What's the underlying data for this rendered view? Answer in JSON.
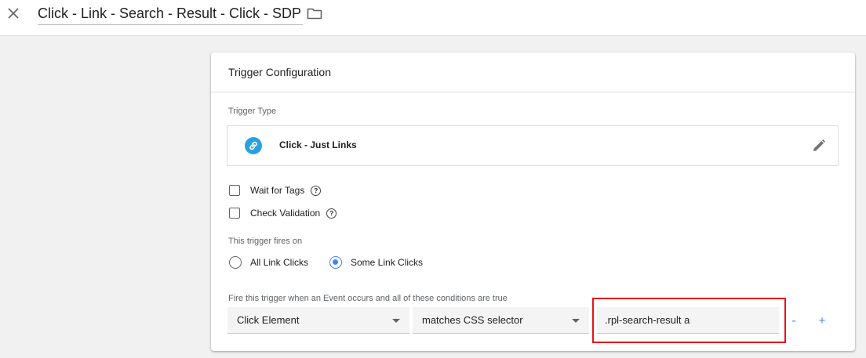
{
  "window": {
    "title": "Click - Link - Search - Result - Click - SDP"
  },
  "card": {
    "header": "Trigger Configuration",
    "trigger_type_label": "Trigger Type",
    "trigger_type_name": "Click - Just Links",
    "options": {
      "wait_for_tags": "Wait for Tags",
      "check_validation": "Check Validation"
    },
    "fires_on_label": "This trigger fires on",
    "fires_on": {
      "all": "All Link Clicks",
      "some": "Some Link Clicks",
      "selected": "some"
    },
    "condition_label": "Fire this trigger when an Event occurs and all of these conditions are true",
    "condition": {
      "variable": "Click Element",
      "operator": "matches CSS selector",
      "value": ".rpl-search-result a"
    },
    "remove_label": "-",
    "add_label": "+"
  },
  "colors": {
    "accent": "#4285f4",
    "link_badge": "#29a1e0",
    "highlight": "#e8131b"
  },
  "icons": [
    "close-icon",
    "folder-icon",
    "link-icon",
    "pencil-icon",
    "help-icon"
  ]
}
